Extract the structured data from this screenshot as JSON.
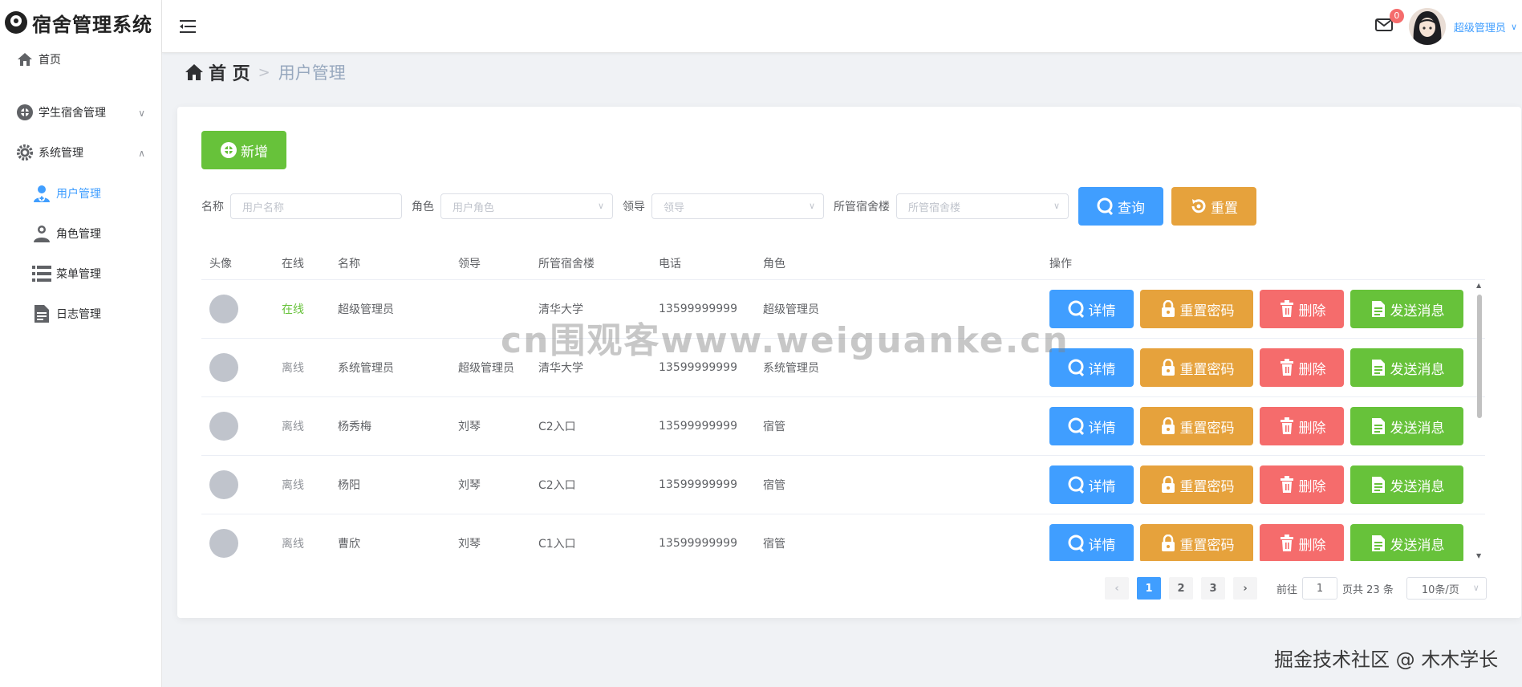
{
  "app": {
    "title": "宿舍管理系统"
  },
  "sidebar": {
    "items": [
      {
        "label": "首页",
        "icon": "home-icon"
      },
      {
        "label": "学生宿舍管理",
        "icon": "dorm-icon",
        "arrow": "∨"
      },
      {
        "label": "系统管理",
        "icon": "gear-icon",
        "arrow": "∧"
      }
    ],
    "sub_items": [
      {
        "label": "用户管理",
        "icon": "user-add-icon",
        "active": true
      },
      {
        "label": "角色管理",
        "icon": "user-icon"
      },
      {
        "label": "菜单管理",
        "icon": "list-icon"
      },
      {
        "label": "日志管理",
        "icon": "document-icon"
      }
    ]
  },
  "header": {
    "badge_count": "0",
    "user_name": "超级管理员",
    "user_arrow": "∨"
  },
  "breadcrumb": {
    "home": "首 页",
    "separator": ">",
    "current": "用户管理"
  },
  "toolbar": {
    "add_label": "新增"
  },
  "filters": {
    "name_label": "名称",
    "name_placeholder": "用户名称",
    "role_label": "角色",
    "role_placeholder": "用户角色",
    "lead_label": "领导",
    "lead_placeholder": "领导",
    "bldg_label": "所管宿舍楼",
    "bldg_placeholder": "所管宿舍楼",
    "query_label": "查询",
    "reset_label": "重置"
  },
  "table": {
    "headers": {
      "avatar": "头像",
      "online": "在线",
      "name": "名称",
      "lead": "领导",
      "bldg": "所管宿舍楼",
      "phone": "电话",
      "role": "角色",
      "ops": "操作"
    },
    "rows": [
      {
        "online": "在线",
        "name": "超级管理员",
        "lead": "",
        "bldg": "清华大学",
        "phone": "13599999999",
        "role": "超级管理员"
      },
      {
        "online": "离线",
        "name": "系统管理员",
        "lead": "超级管理员",
        "bldg": "清华大学",
        "phone": "13599999999",
        "role": "系统管理员"
      },
      {
        "online": "离线",
        "name": "杨秀梅",
        "lead": "刘琴",
        "bldg": "C2入口",
        "phone": "13599999999",
        "role": "宿管"
      },
      {
        "online": "离线",
        "name": "杨阳",
        "lead": "刘琴",
        "bldg": "C2入口",
        "phone": "13599999999",
        "role": "宿管"
      },
      {
        "online": "离线",
        "name": "曹欣",
        "lead": "刘琴",
        "bldg": "C1入口",
        "phone": "13599999999",
        "role": "宿管"
      }
    ],
    "ops": {
      "detail": "详情",
      "reset_pwd": "重置密码",
      "delete": "删除",
      "send_msg": "发送消息"
    }
  },
  "pagination": {
    "prev": "‹",
    "next": "›",
    "pages": [
      "1",
      "2",
      "3"
    ],
    "current": "1",
    "goto_label": "前往",
    "goto_value": "1",
    "total_label": "页共 23 条",
    "page_size": "10条/页",
    "size_arrow": "∨"
  },
  "watermarks": {
    "center": "cn围观客www.weiguanke.cn",
    "corner": "掘金技术社区 @ 木木学长"
  },
  "colors": {
    "primary": "#409eff",
    "success": "#67c23a",
    "warning": "#e6a23c",
    "danger": "#f56c6c"
  }
}
